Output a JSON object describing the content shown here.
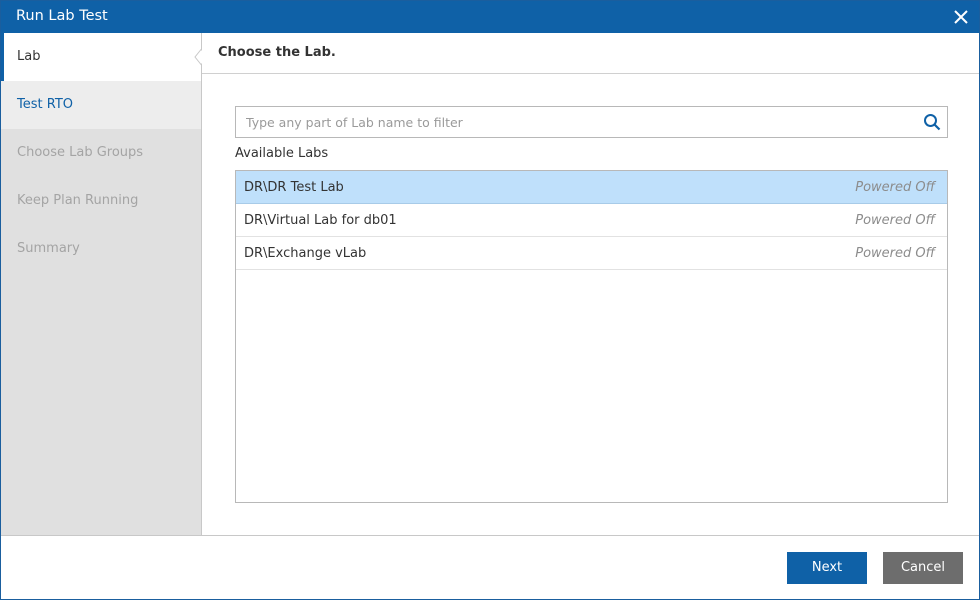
{
  "window": {
    "title": "Run Lab Test"
  },
  "sidebar": {
    "steps": [
      {
        "label": "Lab",
        "state": "active"
      },
      {
        "label": "Test RTO",
        "state": "next"
      },
      {
        "label": "Choose Lab Groups",
        "state": "disabled"
      },
      {
        "label": "Keep Plan Running",
        "state": "disabled"
      },
      {
        "label": "Summary",
        "state": "disabled"
      }
    ]
  },
  "content": {
    "heading": "Choose the Lab.",
    "search": {
      "placeholder": "Type any part of Lab name to filter",
      "value": ""
    },
    "list_label": "Available Labs",
    "labs": [
      {
        "name": "DR\\DR Test Lab",
        "status": "Powered Off",
        "selected": true
      },
      {
        "name": "DR\\Virtual Lab for db01",
        "status": "Powered Off",
        "selected": false
      },
      {
        "name": "DR\\Exchange vLab",
        "status": "Powered Off",
        "selected": false
      }
    ]
  },
  "footer": {
    "next_label": "Next",
    "cancel_label": "Cancel"
  },
  "colors": {
    "titlebar": "#0f61a7",
    "selected_row": "#bfe0fb",
    "next_button": "#0f61a7",
    "cancel_button": "#6d6d6d",
    "sidebar_bg": "#e0e0e0"
  },
  "icons": {
    "close": "close-icon",
    "search": "search-icon"
  }
}
